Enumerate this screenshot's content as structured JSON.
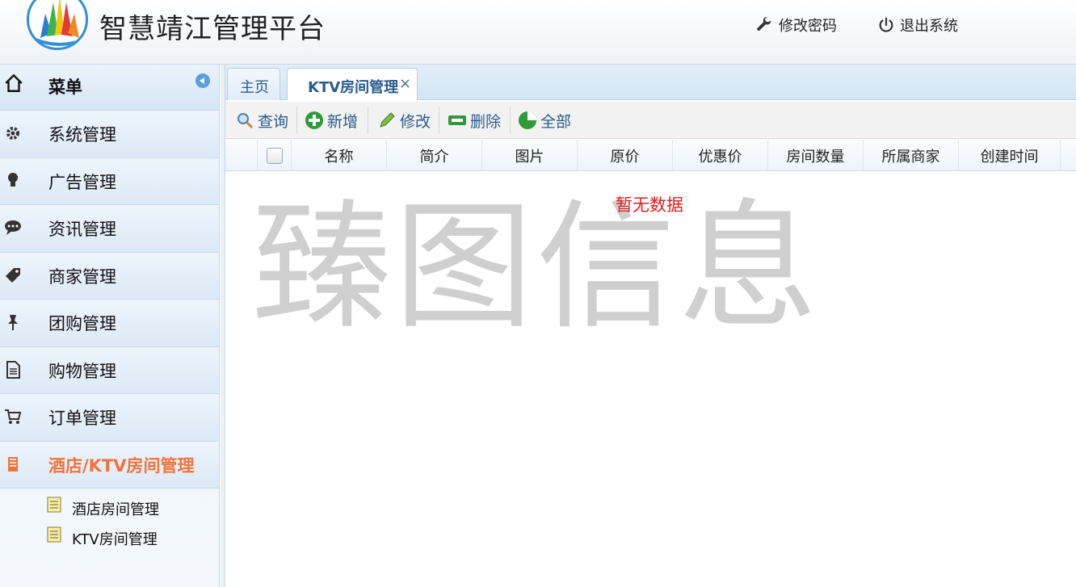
{
  "header": {
    "title": "智慧靖江管理平台",
    "change_password": "修改密码",
    "logout": "退出系统"
  },
  "sidebar": {
    "title": "菜单",
    "items": [
      {
        "label": "系统管理",
        "icon": "gear-icon"
      },
      {
        "label": "广告管理",
        "icon": "lightbulb-icon"
      },
      {
        "label": "资讯管理",
        "icon": "chat-bubble-icon"
      },
      {
        "label": "商家管理",
        "icon": "tag-icon"
      },
      {
        "label": "团购管理",
        "icon": "pin-icon"
      },
      {
        "label": "购物管理",
        "icon": "document-icon"
      },
      {
        "label": "订单管理",
        "icon": "cart-icon"
      },
      {
        "label": "酒店/KTV房间管理",
        "icon": "hotel-icon"
      }
    ],
    "sub_items": [
      {
        "label": "酒店房间管理"
      },
      {
        "label": "KTV房间管理"
      }
    ]
  },
  "tabs": [
    {
      "label": "主页"
    },
    {
      "label": "KTV房间管理",
      "close": "×"
    }
  ],
  "toolbar": {
    "query": "查询",
    "add": "新增",
    "edit": "修改",
    "delete": "删除",
    "all": "全部"
  },
  "grid": {
    "columns": [
      "名称",
      "简介",
      "图片",
      "原价",
      "优惠价",
      "房间数量",
      "所属商家",
      "创建时间"
    ],
    "empty_text": "暂无数据"
  },
  "watermark": "臻图信息",
  "colors": {
    "active_menu": "#f0743a",
    "link_blue": "#2a5b8f",
    "empty_red": "#e21d1d"
  }
}
